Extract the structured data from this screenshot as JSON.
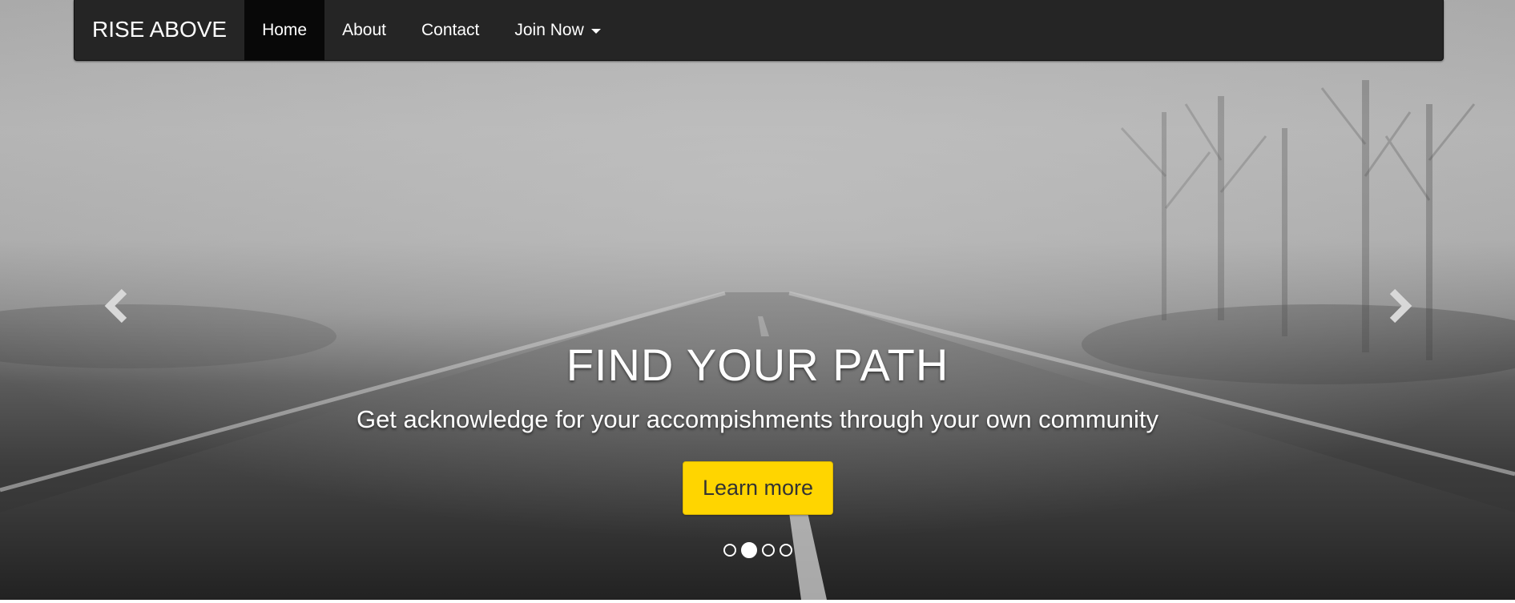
{
  "navbar": {
    "brand": "RISE ABOVE",
    "items": [
      {
        "label": "Home",
        "active": true
      },
      {
        "label": "About",
        "active": false
      },
      {
        "label": "Contact",
        "active": false
      },
      {
        "label": "Join Now",
        "active": false,
        "dropdown": true
      }
    ]
  },
  "carousel": {
    "title": "FIND YOUR PATH",
    "subtitle": "Get acknowledge for your accompishments through your own community",
    "button_label": "Learn more",
    "button_color": "#ffd500",
    "active_slide": 2,
    "slide_count": 4,
    "prev_icon": "chevron-left-icon",
    "next_icon": "chevron-right-icon"
  }
}
